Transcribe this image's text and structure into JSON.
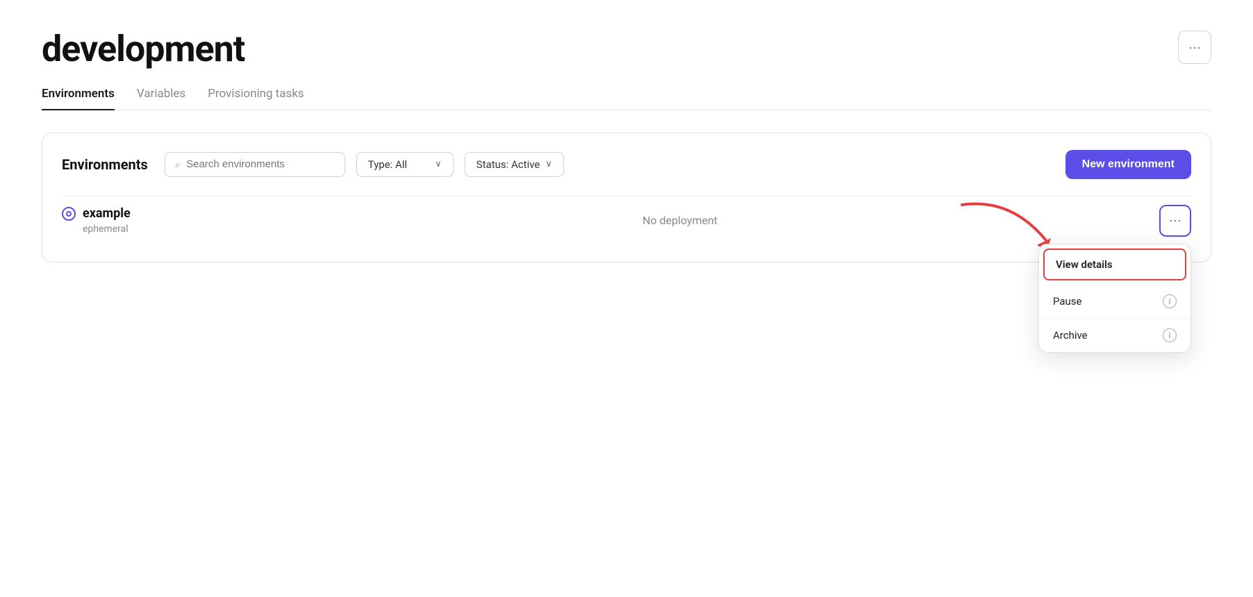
{
  "page": {
    "title": "development"
  },
  "header": {
    "more_button_label": "···"
  },
  "tabs": [
    {
      "id": "environments",
      "label": "Environments",
      "active": true
    },
    {
      "id": "variables",
      "label": "Variables",
      "active": false
    },
    {
      "id": "provisioning_tasks",
      "label": "Provisioning tasks",
      "active": false
    }
  ],
  "environments_section": {
    "label": "Environments",
    "search_placeholder": "Search environments",
    "type_filter_label": "Type: All",
    "status_filter_label": "Status: Active",
    "new_environment_label": "New environment"
  },
  "environments": [
    {
      "id": "example",
      "name": "example",
      "type": "ephemeral",
      "deployment": "No deployment",
      "status": "active"
    }
  ],
  "dropdown_menu": {
    "items": [
      {
        "id": "view-details",
        "label": "View details",
        "highlighted": true,
        "has_info": false
      },
      {
        "id": "pause",
        "label": "Pause",
        "highlighted": false,
        "has_info": true
      },
      {
        "id": "archive",
        "label": "Archive",
        "highlighted": false,
        "has_info": true
      }
    ]
  },
  "icons": {
    "search": "🔍",
    "chevron_down": "⌄",
    "more": "···",
    "info": "i"
  }
}
